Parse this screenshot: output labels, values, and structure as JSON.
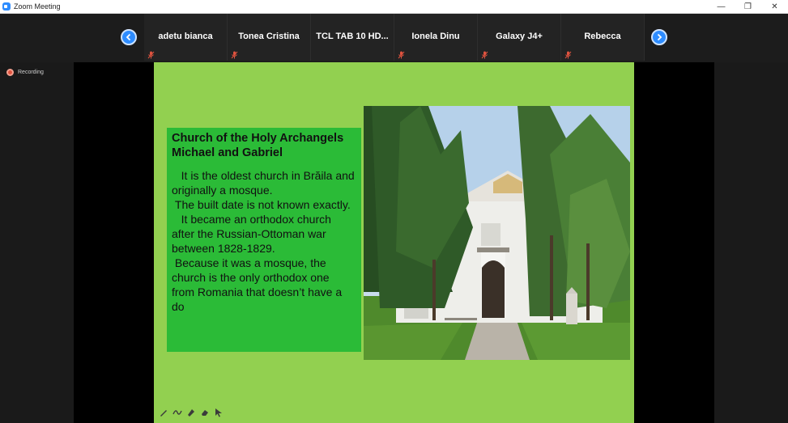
{
  "window": {
    "title": "Zoom Meeting",
    "minimize": "—",
    "restore": "❐",
    "close": "✕"
  },
  "participants": [
    {
      "name": "adetu bianca"
    },
    {
      "name": "Tonea Cristina"
    },
    {
      "name": "TCL TAB 10 HD..."
    },
    {
      "name": "Ionela Dinu"
    },
    {
      "name": "Galaxy J4+"
    },
    {
      "name": "Rebecca"
    }
  ],
  "recording": {
    "label": "Recording"
  },
  "slide": {
    "title": "Church of the Holy Archangels Michael and Gabriel",
    "body": "   It is the oldest church in Brăila and originally a mosque.\n The built date is not known exactly.\n   It became an orthodox church after the Russian-Ottoman war between 1828-1829.\n Because it was a mosque, the church is the only orthodox one from Romania that doesn’t have a do"
  },
  "colors": {
    "slide_bg": "#92d050",
    "textbox_bg": "#2bbb37",
    "accent": "#2d8cff",
    "mic_muted": "#e0533f"
  }
}
